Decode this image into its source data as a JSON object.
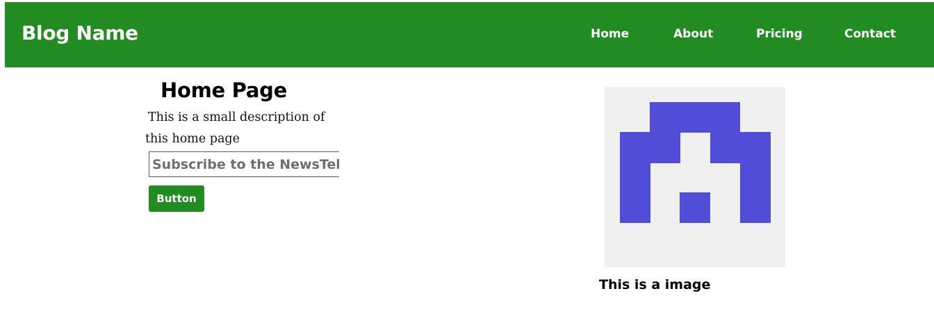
{
  "header": {
    "brand": "Blog Name",
    "nav": [
      {
        "label": "Home"
      },
      {
        "label": "About"
      },
      {
        "label": "Pricing"
      },
      {
        "label": "Contact"
      }
    ]
  },
  "main": {
    "title": "Home Page",
    "description": "This is a small description of this home page",
    "subscribe_placeholder": "Subscribe to the NewsTeller",
    "button_label": "Button"
  },
  "figure": {
    "icon": "identicon-image",
    "caption": "This is a image"
  },
  "colors": {
    "brand_green": "#228b22",
    "identicon_purple": "#524dd8",
    "image_background": "#f0f0f0"
  }
}
